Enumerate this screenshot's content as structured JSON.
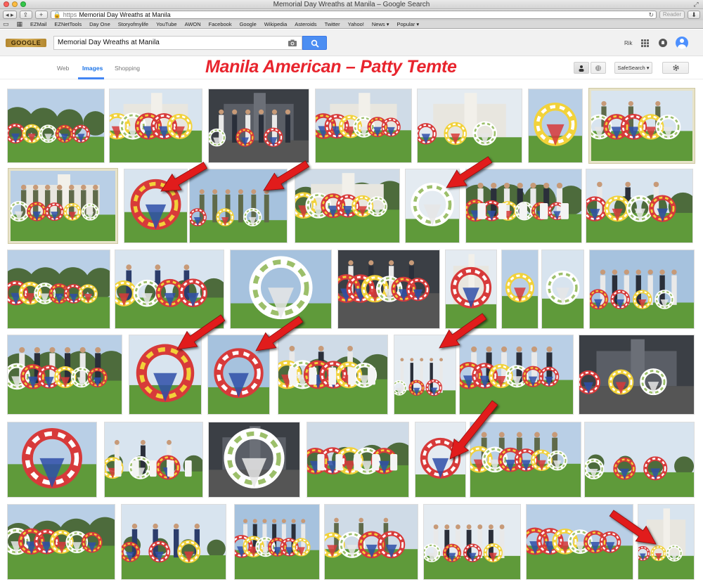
{
  "window": {
    "title": "Memorial Day Wreaths at Manila – Google Search"
  },
  "toolbar": {
    "url_scheme": "https",
    "url_lock_icon": "lock-icon",
    "address": "Memorial Day Wreaths at Manila",
    "reader_label": "Reader",
    "back_icon": "chevron-left-icon",
    "forward_icon": "chevron-right-icon",
    "share_icon": "share-icon",
    "new_tab_icon": "plus-icon"
  },
  "bookmarks": {
    "items": [
      {
        "label": "EZMail"
      },
      {
        "label": "EZNetTools"
      },
      {
        "label": "Day One"
      },
      {
        "label": "Storyofmylife"
      },
      {
        "label": "YouTube"
      },
      {
        "label": "AWON"
      },
      {
        "label": "Facebook"
      },
      {
        "label": "Google"
      },
      {
        "label": "Wikipedia"
      },
      {
        "label": "Asteroids"
      },
      {
        "label": "Twitter"
      },
      {
        "label": "Yahoo!"
      },
      {
        "label": "News ▾"
      },
      {
        "label": "Popular ▾"
      }
    ]
  },
  "google": {
    "logo_text": "GOOGLE",
    "search_query": "Memorial Day Wreaths at Manila",
    "user_name": "Rik",
    "tabs": [
      {
        "label": "Web"
      },
      {
        "label": "Images"
      },
      {
        "label": "Shopping"
      }
    ],
    "active_tab": "Images",
    "safesearch_label": "SafeSearch ▾",
    "overlay_caption": "Manila American – Patty Temte",
    "accent_color": "#4285f4",
    "caption_color": "#e8242d"
  },
  "results": {
    "row_count": 6,
    "rows": [
      [
        "lawn-wreaths",
        "white-building-wreaths",
        "speaker-podium",
        "monument-plaza",
        "memorial-wall",
        "wreath-closeup",
        "honor-guard-framed"
      ],
      [
        "grandstand-guard",
        "wreath-closeup",
        "honor-guard-wreath",
        "tents-ceremony",
        "wreath-on-stand",
        "grave-flags",
        "officials-lawn"
      ],
      [
        "tree-ceremony",
        "airmen-wreaths",
        "flower-wreath",
        "officials-handshake",
        "white-wreath",
        "small-wreath",
        "small-wreath",
        "couple-wreath"
      ],
      [
        "troop-formation",
        "yellow-wreath",
        "blue-yellow-wreath",
        "flag-ceremony",
        "woman-wreath",
        "marching-wreaths",
        "mosaic-wall"
      ],
      [
        "blue-wreath-seal",
        "flag-field",
        "white-wreath-dark",
        "boy-crosses",
        "blue-wreath-seal",
        "officers-wreaths",
        "ceremony-field"
      ],
      [
        "wreath-row",
        "air-force-line",
        "group-photo",
        "officers-standing",
        "veterans-group",
        "wreath-displays",
        "pavilion-wreaths"
      ]
    ]
  }
}
